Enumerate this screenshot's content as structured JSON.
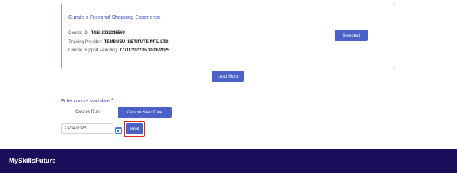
{
  "course": {
    "title": "Curate a Personal Shopping Experience",
    "course_id_label": "Course ID:",
    "course_id": "TGS-2022016569",
    "provider_label": "Training Provider:",
    "provider": "TEMBUSU INSTITUTE PTE. LTD.",
    "support_label": "Course Support Period(s):",
    "support_period": "01/11/2022 to 30/06/2025",
    "selected_label": "Selected"
  },
  "load_more_label": "Load More",
  "start_date": {
    "label": "Enter course start date",
    "required_mark": "*",
    "course_run_label": "Course Run",
    "course_start_date_label": "Course Start Date",
    "date_value": "23/04/2025",
    "next_label": "Next",
    "highlight_color": "#e0261f"
  },
  "footer": {
    "brand": "MySkillsFuture"
  },
  "colors": {
    "accent": "#4a62c8",
    "footer_bg": "#1b0f5c",
    "title": "#4a55c8"
  },
  "icons": {
    "date_picker": "calendar-icon"
  }
}
